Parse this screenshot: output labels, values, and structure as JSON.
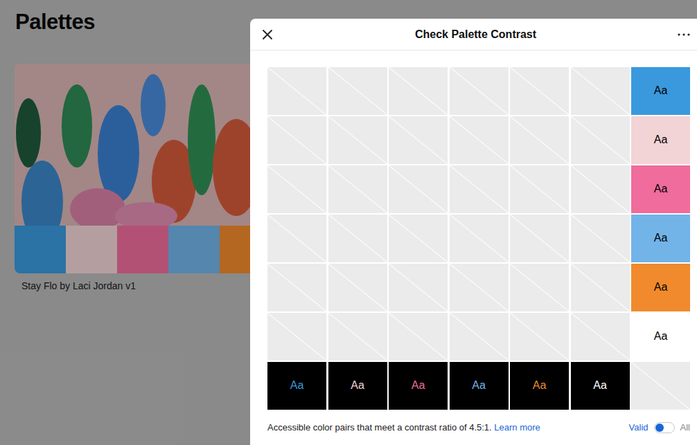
{
  "page": {
    "heading": "Palettes"
  },
  "card": {
    "title": "Stay Flo by Laci Jordan v1",
    "swatches": [
      {
        "color": "#3a99dc"
      },
      {
        "color": "#f2d3d6"
      },
      {
        "color": "#ef6c9c"
      },
      {
        "color": "#72b3e8"
      },
      {
        "color": "#f08a2c"
      },
      {
        "color": "#ffffff"
      }
    ]
  },
  "modal": {
    "title": "Check Palette Contrast",
    "matrix": {
      "rows": [
        [
          {
            "kind": "empty"
          },
          {
            "kind": "empty"
          },
          {
            "kind": "empty"
          },
          {
            "kind": "empty"
          },
          {
            "kind": "empty"
          },
          {
            "kind": "empty"
          },
          {
            "kind": "sample",
            "label": "Aa",
            "background": "#3a99dc",
            "color": "#000000"
          }
        ],
        [
          {
            "kind": "empty"
          },
          {
            "kind": "empty"
          },
          {
            "kind": "empty"
          },
          {
            "kind": "empty"
          },
          {
            "kind": "empty"
          },
          {
            "kind": "empty"
          },
          {
            "kind": "sample",
            "label": "Aa",
            "background": "#f2d3d6",
            "color": "#000000"
          }
        ],
        [
          {
            "kind": "empty"
          },
          {
            "kind": "empty"
          },
          {
            "kind": "empty"
          },
          {
            "kind": "empty"
          },
          {
            "kind": "empty"
          },
          {
            "kind": "empty"
          },
          {
            "kind": "sample",
            "label": "Aa",
            "background": "#ef6c9c",
            "color": "#000000"
          }
        ],
        [
          {
            "kind": "empty"
          },
          {
            "kind": "empty"
          },
          {
            "kind": "empty"
          },
          {
            "kind": "empty"
          },
          {
            "kind": "empty"
          },
          {
            "kind": "empty"
          },
          {
            "kind": "sample",
            "label": "Aa",
            "background": "#72b3e8",
            "color": "#000000"
          }
        ],
        [
          {
            "kind": "empty"
          },
          {
            "kind": "empty"
          },
          {
            "kind": "empty"
          },
          {
            "kind": "empty"
          },
          {
            "kind": "empty"
          },
          {
            "kind": "empty"
          },
          {
            "kind": "sample",
            "label": "Aa",
            "background": "#f08a2c",
            "color": "#000000"
          }
        ],
        [
          {
            "kind": "empty"
          },
          {
            "kind": "empty"
          },
          {
            "kind": "empty"
          },
          {
            "kind": "empty"
          },
          {
            "kind": "empty"
          },
          {
            "kind": "empty"
          },
          {
            "kind": "sample",
            "label": "Aa",
            "background": "#ffffff",
            "color": "#000000"
          }
        ],
        [
          {
            "kind": "sample",
            "label": "Aa",
            "background": "#000000",
            "color": "#3a99dc"
          },
          {
            "kind": "sample",
            "label": "Aa",
            "background": "#000000",
            "color": "#f2d3d6"
          },
          {
            "kind": "sample",
            "label": "Aa",
            "background": "#000000",
            "color": "#ef6c9c"
          },
          {
            "kind": "sample",
            "label": "Aa",
            "background": "#000000",
            "color": "#72b3e8"
          },
          {
            "kind": "sample",
            "label": "Aa",
            "background": "#000000",
            "color": "#f08a2c"
          },
          {
            "kind": "sample",
            "label": "Aa",
            "background": "#000000",
            "color": "#ffffff"
          },
          {
            "kind": "empty"
          }
        ]
      ]
    },
    "footer": {
      "note": "Accessible color pairs that meet a contrast ratio of 4.5:1.",
      "link": "Learn more",
      "filter": [
        {
          "label": "Valid",
          "selected": true
        },
        {
          "label": "All",
          "selected": false
        }
      ]
    }
  }
}
